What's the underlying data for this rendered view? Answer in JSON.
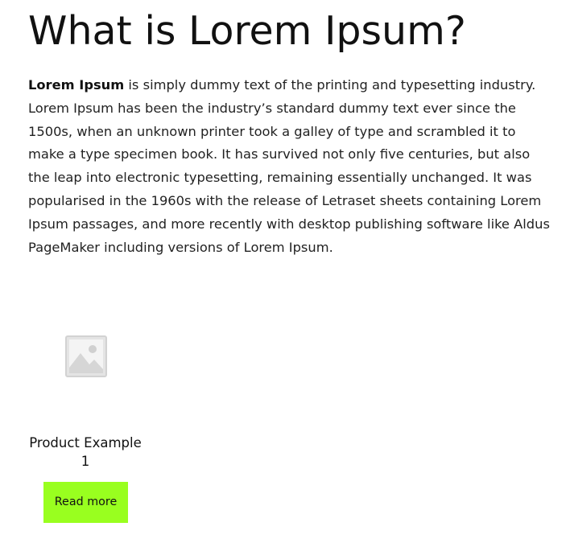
{
  "article": {
    "title": "What is Lorem Ipsum?",
    "intro_bold": "Lorem Ipsum",
    "intro_text": " is simply dummy text of the printing and typesetting industry. Lorem Ipsum has been the industry’s standard dummy text ever since the 1500s, when an unknown printer took a galley of type and scrambled it to make a type specimen book. It has survived not only five centuries, but also the leap into electronic typesetting, remaining essentially unchanged. It was popularised in the 1960s with the release of Letraset sheets containing Lorem Ipsum passages, and more recently with desktop publishing software like Aldus PageMaker including versions of Lorem Ipsum."
  },
  "product": {
    "name": "Product Example 1",
    "image_icon": "image-placeholder-icon",
    "button_label": "Read more",
    "button_color": "#99ff1f"
  }
}
